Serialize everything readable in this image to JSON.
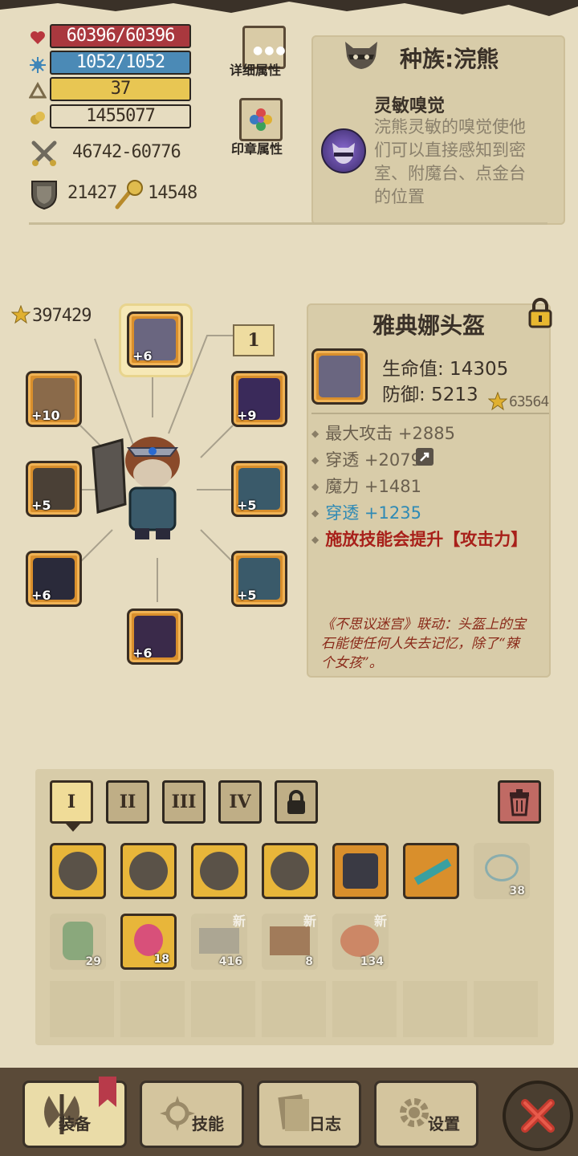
{
  "stats": {
    "hp": "60396/60396",
    "mp": "1052/1052",
    "level": "37",
    "gold": "1455077",
    "attack": "46742-60776",
    "defense": "21427",
    "magic": "14548"
  },
  "buttons": {
    "detail_attrs": "详细属性",
    "seal_attrs": "印章属性"
  },
  "race": {
    "title": "种族:浣熊",
    "skill_name": "灵敏嗅觉",
    "skill_desc": "浣熊灵敏的嗅觉使他们可以直接感知到密室、附魔台、点金台的位置"
  },
  "equipment": {
    "total_score": "397429",
    "page_indicator": "1",
    "slots": [
      {
        "name": "helmet",
        "level": "+6"
      },
      {
        "name": "ring",
        "level": "+10"
      },
      {
        "name": "cape",
        "level": "+9"
      },
      {
        "name": "weapon",
        "level": "+5"
      },
      {
        "name": "armor",
        "level": "+5"
      },
      {
        "name": "gloves",
        "level": "+6"
      },
      {
        "name": "skirt",
        "level": "+5"
      },
      {
        "name": "boots",
        "level": "+6"
      }
    ]
  },
  "item": {
    "name": "雅典娜头盔",
    "hp": "生命值: 14305",
    "defense": "防御: 5213",
    "score": "63564",
    "attrs": [
      {
        "text": "最大攻击 +2885",
        "color": "#6a5f4e"
      },
      {
        "text": "穿透 +2079",
        "color": "#6a5f4e"
      },
      {
        "text": "魔力 +1481",
        "color": "#6a5f4e"
      },
      {
        "text": "穿透 +1235",
        "color": "#2f8ab5"
      },
      {
        "text": "施放技能会提升【攻击力】",
        "color": "#a8201a"
      }
    ],
    "lore": "《不思议迷宫》联动：头盔上的宝石能使任何人失去记忆，除了“辣个女孩”。"
  },
  "bag_tabs": [
    "I",
    "II",
    "III",
    "IV"
  ],
  "inventory": [
    {
      "kind": "locked-gear",
      "count": ""
    },
    {
      "kind": "locked-gear",
      "count": ""
    },
    {
      "kind": "locked-gear",
      "count": ""
    },
    {
      "kind": "locked-gear",
      "count": ""
    },
    {
      "kind": "chest-armor",
      "count": ""
    },
    {
      "kind": "teal-weapon",
      "count": ""
    },
    {
      "kind": "eye-scroll",
      "count": "38"
    },
    {
      "kind": "potion",
      "count": "29"
    },
    {
      "kind": "pink-potion",
      "count": "18"
    },
    {
      "kind": "stone",
      "count": "416",
      "badge": "新"
    },
    {
      "kind": "treasure-chest",
      "count": "8",
      "badge": "新"
    },
    {
      "kind": "meat",
      "count": "134",
      "badge": "新"
    }
  ],
  "nav": {
    "equip": "装备",
    "skills": "技能",
    "log": "日志",
    "settings": "设置"
  },
  "colors": {
    "hp_bar": "#a9383e",
    "mp_bar": "#4b8ab6",
    "level_bar": "#e8c653",
    "gold_bar": "#e6dcc0",
    "slot_orange": "#d98f2c",
    "close_red": "#c33a2e"
  }
}
